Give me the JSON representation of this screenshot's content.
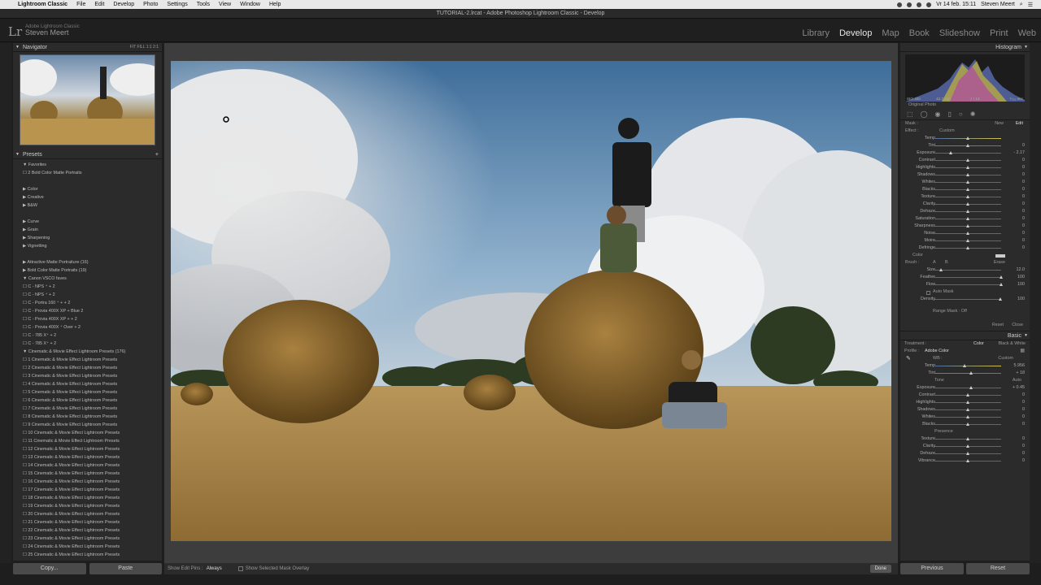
{
  "menubar": {
    "items": [
      "Lightroom Classic",
      "File",
      "Edit",
      "Develop",
      "Photo",
      "Settings",
      "Tools",
      "View",
      "Window",
      "Help"
    ],
    "datetime": "Vr 14 feb. 15:11",
    "user": "Steven Meert"
  },
  "titlebar": {
    "title": "TUTORIAL-2.lrcat - Adobe Photoshop Lightroom Classic - Develop"
  },
  "identity": {
    "logo": "Lr",
    "product": "Adobe Lightroom Classic",
    "name": "Steven Meert"
  },
  "modules": [
    "Library",
    "Develop",
    "Map",
    "Book",
    "Slideshow",
    "Print",
    "Web"
  ],
  "active_module": "Develop",
  "navigator": {
    "title": "Navigator",
    "zoom": [
      "FIT",
      "FILL",
      "1:1",
      "2:1"
    ]
  },
  "presets": {
    "title": "Presets",
    "items": [
      "▼ Favorites",
      "   ☐ 2 Bold Color Matte Portraits",
      "",
      "▶ Color",
      "▶ Creative",
      "▶ B&W",
      "",
      "▶ Curve",
      "▶ Grain",
      "▶ Sharpening",
      "▶ Vignetting",
      "",
      "▶ Attractive Matte Portraiture (16)",
      "▶ Bold Color Matte Portraits (19)",
      "▼ Canon VSCO faves",
      "   ☐ C - NPS ⁺ + 2",
      "   ☐ C - NPS ⁺ + 2",
      "   ☐ C - Portra 160 ⁺ + + 2",
      "   ☐ C - Provia 400X XP + Blue 2",
      "   ☐ C - Provia 400X XP + + 2",
      "   ☐ C - Provia 400X ⁺ Over + 2",
      "   ☐ C - 785 X⁺ + 2",
      "   ☐ C - 785 X⁺ + 2",
      "▼ Cinematic & Movie Effect Lightroom Presets (176)",
      "   ☐ 1 Cinematic & Movie Effect Lightroom Presets",
      "   ☐ 2 Cinematic & Movie Effect Lightroom Presets",
      "   ☐ 3 Cinematic & Movie Effect Lightroom Presets",
      "   ☐ 4 Cinematic & Movie Effect Lightroom Presets",
      "   ☐ 5 Cinematic & Movie Effect Lightroom Presets",
      "   ☐ 6 Cinematic & Movie Effect Lightroom Presets",
      "   ☐ 7 Cinematic & Movie Effect Lightroom Presets",
      "   ☐ 8 Cinematic & Movie Effect Lightroom Presets",
      "   ☐ 9 Cinematic & Movie Effect Lightroom Presets",
      "   ☐ 10 Cinematic & Movie Effect Lightroom Presets",
      "   ☐ 11 Cinematic & Movie Effect Lightroom Presets",
      "   ☐ 12 Cinematic & Movie Effect Lightroom Presets",
      "   ☐ 13 Cinematic & Movie Effect Lightroom Presets",
      "   ☐ 14 Cinematic & Movie Effect Lightroom Presets",
      "   ☐ 15 Cinematic & Movie Effect Lightroom Presets",
      "   ☐ 16 Cinematic & Movie Effect Lightroom Presets",
      "   ☐ 17 Cinematic & Movie Effect Lightroom Presets",
      "   ☐ 18 Cinematic & Movie Effect Lightroom Presets",
      "   ☐ 19 Cinematic & Movie Effect Lightroom Presets",
      "   ☐ 20 Cinematic & Movie Effect Lightroom Presets",
      "   ☐ 21 Cinematic & Movie Effect Lightroom Presets",
      "   ☐ 22 Cinematic & Movie Effect Lightroom Presets",
      "   ☐ 23 Cinematic & Movie Effect Lightroom Presets",
      "   ☐ 24 Cinematic & Movie Effect Lightroom Presets",
      "   ☐ 25 Cinematic & Movie Effect Lightroom Presets"
    ]
  },
  "leftbuttons": {
    "copy": "Copy...",
    "paste": "Paste"
  },
  "toolbar": {
    "show_edit_pins": "Show Edit Pins :",
    "pins_value": "Always",
    "overlay": "Show Selected Mask Overlay",
    "done": "Done"
  },
  "histogram": {
    "title": "Histogram",
    "iso": "ISO 400",
    "focal": "42.7 mm",
    "aperture": "ƒ / 13",
    "shutter": "¹⁄₂₅₀ sec",
    "original": "Original Photo"
  },
  "mask": {
    "mask_label": "Mask :",
    "new": "New",
    "edit": "Edit",
    "effect_label": "Effect :",
    "effect_value": "Custom",
    "sliders": [
      {
        "label": "Temp",
        "value": "",
        "pos": 0.5
      },
      {
        "label": "Tint",
        "value": "0",
        "pos": 0.5
      },
      {
        "label": "Exposure",
        "value": "- 2.17",
        "pos": 0.24
      },
      {
        "label": "Contrast",
        "value": "0",
        "pos": 0.5
      },
      {
        "label": "Highlights",
        "value": "0",
        "pos": 0.5
      },
      {
        "label": "Shadows",
        "value": "0",
        "pos": 0.5
      },
      {
        "label": "Whites",
        "value": "0",
        "pos": 0.5
      },
      {
        "label": "Blacks",
        "value": "0",
        "pos": 0.5
      },
      {
        "label": "Texture",
        "value": "0",
        "pos": 0.5
      },
      {
        "label": "Clarity",
        "value": "0",
        "pos": 0.5
      },
      {
        "label": "Dehaze",
        "value": "0",
        "pos": 0.5
      },
      {
        "label": "Saturation",
        "value": "0",
        "pos": 0.5
      },
      {
        "label": "Sharpness",
        "value": "0",
        "pos": 0.5
      },
      {
        "label": "Noise",
        "value": "0",
        "pos": 0.5
      },
      {
        "label": "Moire",
        "value": "0",
        "pos": 0.5
      },
      {
        "label": "Defringe",
        "value": "0",
        "pos": 0.5
      }
    ],
    "color_label": "Color",
    "brush_label": "Brush :",
    "brush_a": "A",
    "brush_b": "B",
    "erase": "Erase",
    "brush_sliders": [
      {
        "label": "Size",
        "value": "12.0",
        "pos": 0.1
      },
      {
        "label": "Feather",
        "value": "100",
        "pos": 1.0
      },
      {
        "label": "Flow",
        "value": "100",
        "pos": 1.0
      }
    ],
    "automask": "Auto Mask",
    "density_label": "Density",
    "density_value": "100",
    "range_mask": "Range Mask : Off",
    "reset": "Reset",
    "close": "Close"
  },
  "basic": {
    "title": "Basic",
    "treatment_label": "Treatment :",
    "color": "Color",
    "bw": "Black & White",
    "profile_label": "Profile :",
    "profile_value": "Adobe Color",
    "wb_label": "WB :",
    "wb_value": "Custom",
    "temp": {
      "label": "Temp",
      "value": "5.956",
      "pos": 0.45
    },
    "tint": {
      "label": "Tint",
      "value": "+ 18",
      "pos": 0.55
    },
    "tone_label": "Tone",
    "auto": "Auto",
    "tone": [
      {
        "label": "Exposure",
        "value": "+ 0.45",
        "pos": 0.55
      },
      {
        "label": "Contrast",
        "value": "0",
        "pos": 0.5
      },
      {
        "label": "Highlights",
        "value": "0",
        "pos": 0.5
      },
      {
        "label": "Shadows",
        "value": "0",
        "pos": 0.5
      },
      {
        "label": "Whites",
        "value": "0",
        "pos": 0.5
      },
      {
        "label": "Blacks",
        "value": "0",
        "pos": 0.5
      }
    ],
    "presence_label": "Presence",
    "presence": [
      {
        "label": "Texture",
        "value": "0",
        "pos": 0.5
      },
      {
        "label": "Clarity",
        "value": "0",
        "pos": 0.5
      },
      {
        "label": "Dehaze",
        "value": "0",
        "pos": 0.5
      },
      {
        "label": "Vibrance",
        "value": "0",
        "pos": 0.5
      }
    ]
  },
  "rightbuttons": {
    "previous": "Previous",
    "reset": "Reset"
  }
}
